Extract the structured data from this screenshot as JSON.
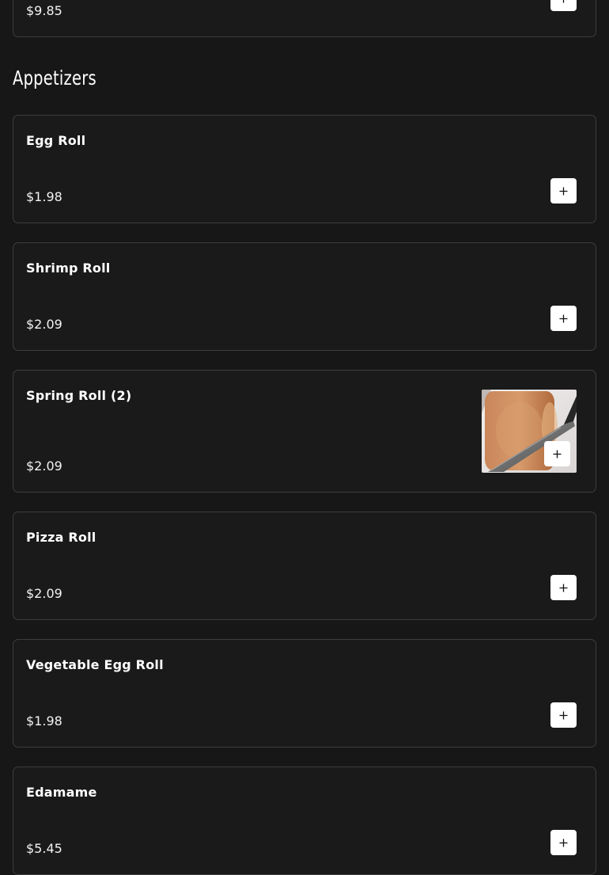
{
  "previous_item": {
    "price": "$9.85"
  },
  "section": {
    "title": "Appetizers"
  },
  "items": [
    {
      "name": "Egg Roll",
      "price": "$1.98"
    },
    {
      "name": "Shrimp Roll",
      "price": "$2.09"
    },
    {
      "name": "Spring Roll (2)",
      "price": "$2.09"
    },
    {
      "name": "Pizza Roll",
      "price": "$2.09"
    },
    {
      "name": "Vegetable Egg Roll",
      "price": "$1.98"
    },
    {
      "name": "Edamame",
      "price": "$5.45"
    }
  ],
  "icons": {
    "add": "plus-icon"
  },
  "colors": {
    "background": "#171717",
    "card_border": "#3d3d3d",
    "button": "#ffffff"
  }
}
